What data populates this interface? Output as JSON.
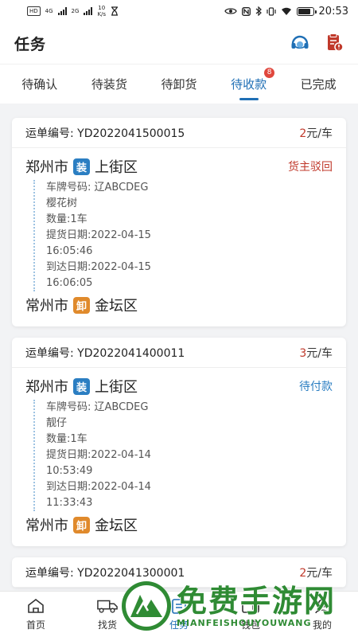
{
  "status_bar": {
    "left_badge": "HD",
    "net_a": "4G",
    "net_b": "2G",
    "speed_value": "10",
    "speed_unit": "K/s",
    "time": "20:53"
  },
  "header": {
    "title": "任务",
    "icons": [
      "headset-icon",
      "document-alert-icon"
    ]
  },
  "tabs": [
    {
      "label": "待确认",
      "active": false
    },
    {
      "label": "待装货",
      "active": false
    },
    {
      "label": "待卸货",
      "active": false
    },
    {
      "label": "待收款",
      "active": true,
      "badge": "8"
    },
    {
      "label": "已完成",
      "active": false
    }
  ],
  "orders": [
    {
      "waybill": "运单编号:  YD2022041500015",
      "price_num": "2",
      "price_unit": "元/车",
      "from_city": "郑州市",
      "from_tag": "装",
      "from_district": "上街区",
      "status": "货主驳回",
      "plate": "车牌号码:  辽ABCDEG",
      "goods": "樱花树",
      "qty": "数量:1车",
      "pickup_date": "提货日期:2022-04-15",
      "pickup_time": "16:05:46",
      "arrive_date": "到达日期:2022-04-15",
      "arrive_time": "16:06:05",
      "to_city": "常州市",
      "to_tag": "卸",
      "to_district": "金坛区"
    },
    {
      "waybill": "运单编号:  YD2022041400011",
      "price_num": "3",
      "price_unit": "元/车",
      "from_city": "郑州市",
      "from_tag": "装",
      "from_district": "上街区",
      "status": "待付款",
      "plate": "车牌号码:  辽ABCDEG",
      "goods": "靓仔",
      "qty": "数量:1车",
      "pickup_date": "提货日期:2022-04-14",
      "pickup_time": "10:53:49",
      "arrive_date": "到达日期:2022-04-14",
      "arrive_time": "11:33:43",
      "to_city": "常州市",
      "to_tag": "卸",
      "to_district": "金坛区"
    },
    {
      "waybill": "运单编号:  YD2022041300001",
      "price_num": "2",
      "price_unit": "元/车"
    }
  ],
  "bottom_nav": [
    {
      "label": "首页",
      "icon": "home-icon"
    },
    {
      "label": "找货",
      "icon": "truck-icon"
    },
    {
      "label": "任务",
      "icon": "task-icon",
      "active": true
    },
    {
      "label": "钱包",
      "icon": "wallet-icon"
    },
    {
      "label": "我的",
      "icon": "user-icon"
    }
  ],
  "watermark": {
    "title": "免费手游网",
    "subtitle": "MIANFEISHOUYOUWANG"
  },
  "colors": {
    "accent": "#1f6fb5",
    "load_tag": "#2b7ec2",
    "unload_tag": "#e08a2c",
    "reject": "#c0392b",
    "watermark_green": "#2f8b34"
  }
}
